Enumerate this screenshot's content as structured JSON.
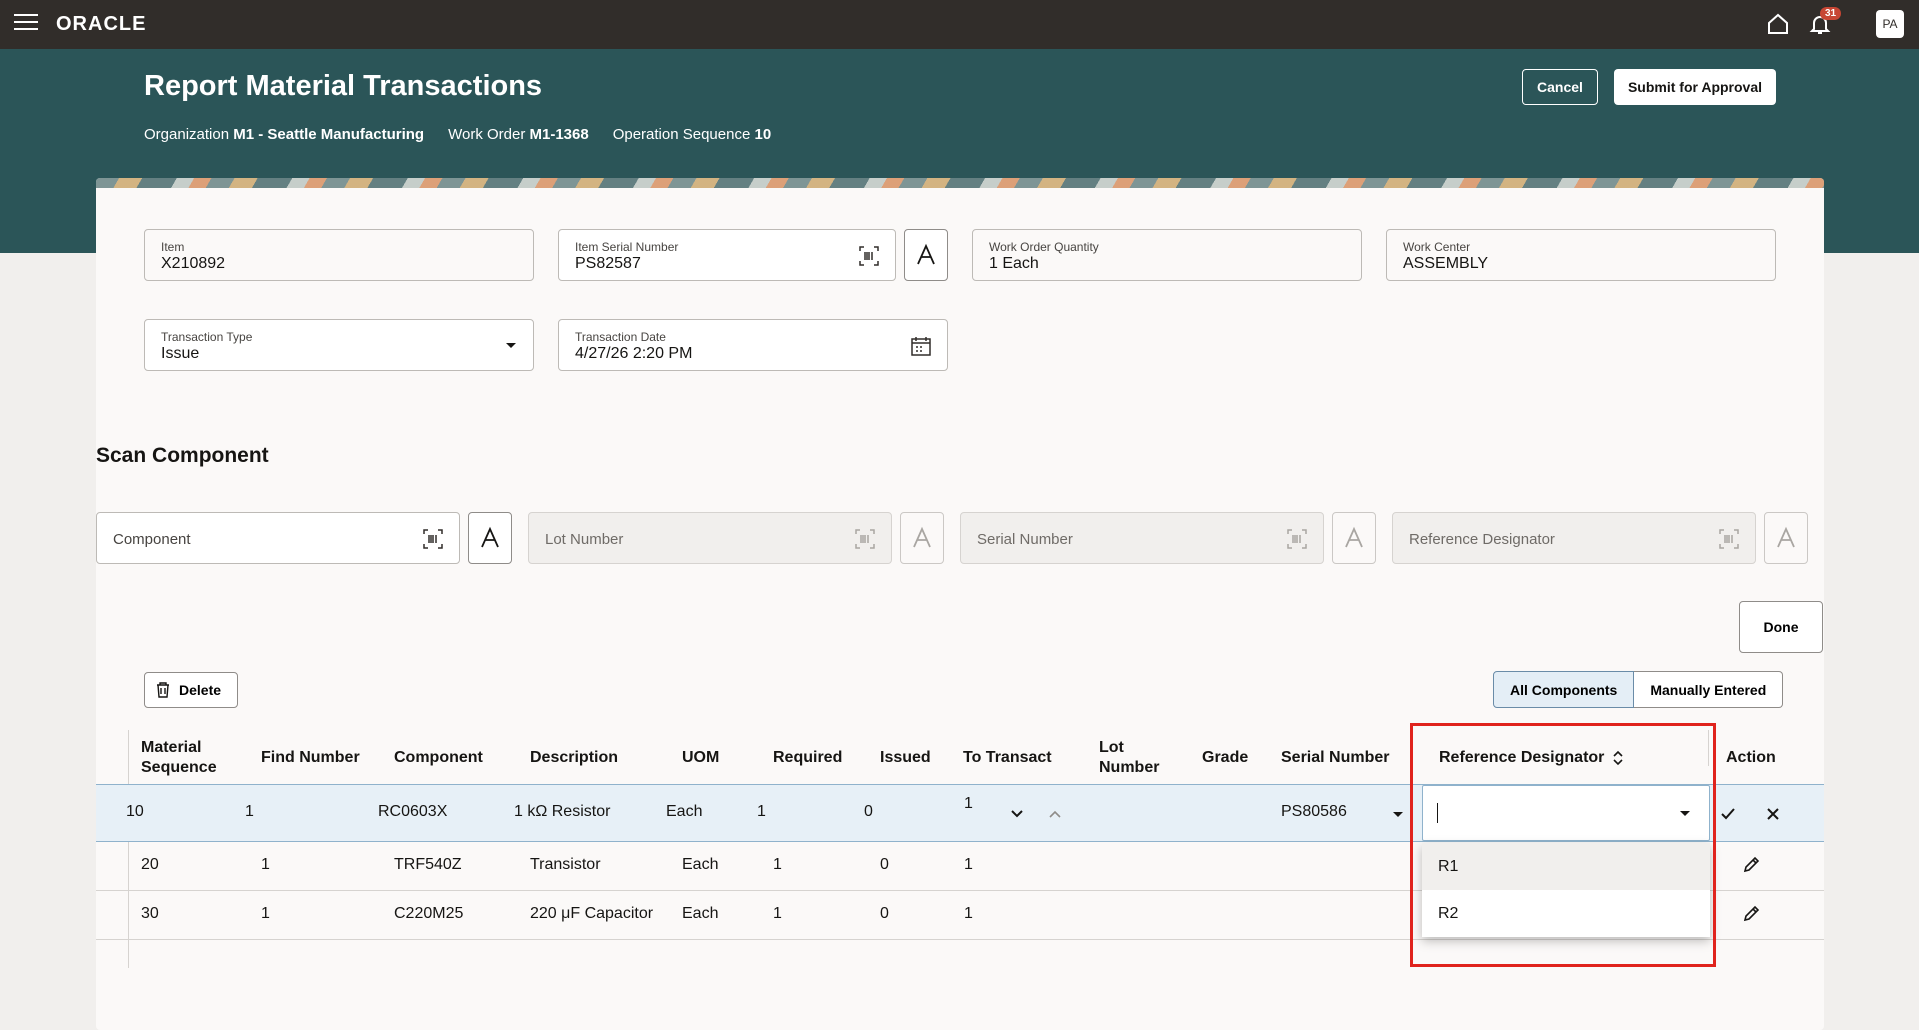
{
  "topbar": {
    "brand": "ORACLE",
    "notification_count": "31",
    "avatar_initials": "PA"
  },
  "header": {
    "title": "Report Material Transactions",
    "context": [
      {
        "label": "Organization",
        "value": "M1 - Seattle Manufacturing"
      },
      {
        "label": "Work Order",
        "value": "M1-1368"
      },
      {
        "label": "Operation Sequence",
        "value": "10"
      }
    ],
    "cancel_label": "Cancel",
    "submit_label": "Submit for Approval"
  },
  "form": {
    "item": {
      "label": "Item",
      "value": "X210892"
    },
    "item_serial": {
      "label": "Item Serial Number",
      "value": "PS82587"
    },
    "wo_qty": {
      "label": "Work Order Quantity",
      "value": "1 Each"
    },
    "work_center": {
      "label": "Work Center",
      "value": "ASSEMBLY"
    },
    "txn_type": {
      "label": "Transaction Type",
      "value": "Issue"
    },
    "txn_date": {
      "label": "Transaction Date",
      "value": "4/27/26 2:20 PM"
    }
  },
  "scan": {
    "title": "Scan Component",
    "component_ph": "Component",
    "lot_ph": "Lot Number",
    "serial_ph": "Serial Number",
    "refdes_ph": "Reference Designator",
    "done_label": "Done"
  },
  "toolbar": {
    "delete_label": "Delete",
    "filter_all": "All Components",
    "filter_manual": "Manually Entered"
  },
  "table": {
    "headers": {
      "material_sequence_1": "Material",
      "material_sequence_2": "Sequence",
      "find_number": "Find Number",
      "component": "Component",
      "description": "Description",
      "uom": "UOM",
      "required": "Required",
      "issued": "Issued",
      "to_transact": "To Transact",
      "lot_number_1": "Lot",
      "lot_number_2": "Number",
      "grade": "Grade",
      "serial_number": "Serial Number",
      "reference_designator": "Reference Designator",
      "action": "Action"
    },
    "rows": [
      {
        "seq": "10",
        "find": "1",
        "component": "RC0603X",
        "description": "1 kΩ Resistor",
        "uom": "Each",
        "required": "1",
        "issued": "0",
        "to_transact": "1",
        "serial": "PS80586"
      },
      {
        "seq": "20",
        "find": "1",
        "component": "TRF540Z",
        "description": "Transistor",
        "uom": "Each",
        "required": "1",
        "issued": "0",
        "to_transact": "1"
      },
      {
        "seq": "30",
        "find": "1",
        "component": "C220M25",
        "description": "220 μF Capacitor",
        "uom": "Each",
        "required": "1",
        "issued": "0",
        "to_transact": "1"
      }
    ],
    "refdes_options": [
      "R1",
      "R2"
    ]
  },
  "colors": {
    "topbar": "#312d2a",
    "header_band": "#2b5558",
    "highlight_box": "#e0231d"
  }
}
